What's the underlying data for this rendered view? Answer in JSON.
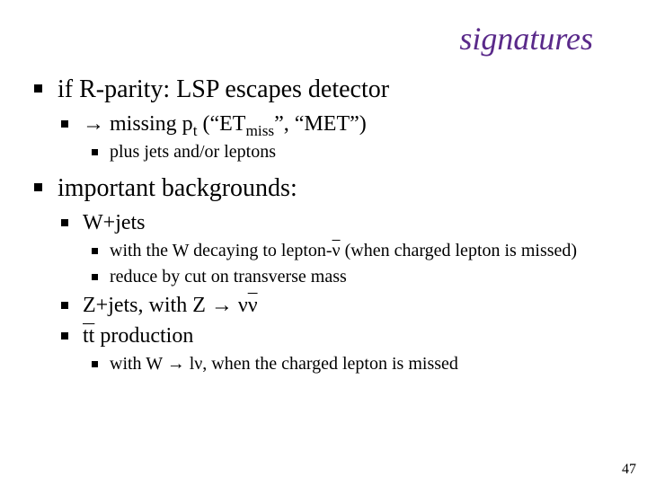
{
  "title": "signatures",
  "bullets": {
    "l1a": "if R-parity: LSP escapes detector",
    "l2a_pre": " → missing p",
    "l2a_sub": "t",
    "l2a_mid": "  (“ET",
    "l2a_sub2": "miss",
    "l2a_post": "”, “MET”)",
    "l3a": "plus jets and/or leptons",
    "l1b": "important backgrounds:",
    "l2b": "W+jets",
    "l3b_pre": "with the W decaying to lepton-",
    "l3b_nu": "ν",
    "l3b_post": " (when charged lepton is missed)",
    "l3c": "reduce by cut on transverse mass",
    "l2c_pre": "Z+jets, with Z → ν",
    "l2c_nu": "ν",
    "l2d_tt": "tt",
    "l2d_post": " production",
    "l3d": "with W → lν, when the charged lepton is missed"
  },
  "page_number": "47"
}
